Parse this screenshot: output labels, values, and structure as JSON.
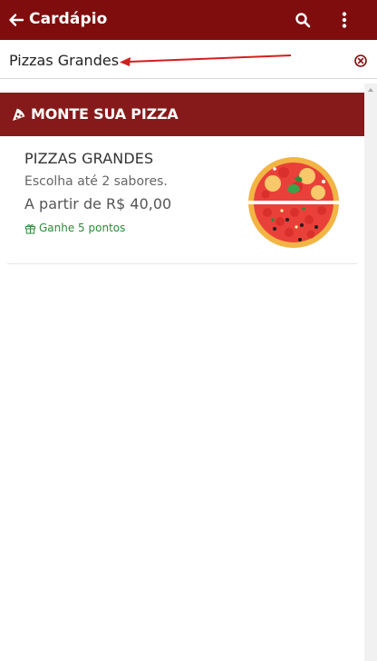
{
  "appbar": {
    "title": "Cardápio",
    "back_icon": "arrow-left-icon",
    "search_icon": "search-icon",
    "more_icon": "more-vertical-icon",
    "color": "#7f0d0d"
  },
  "search": {
    "value": "Pizzas Grandes",
    "placeholder": "",
    "clear_icon": "clear-circle-icon"
  },
  "section": {
    "title": "MONTE SUA PIZZA",
    "icon": "pizza-slice-icon",
    "color": "#861a1a"
  },
  "product": {
    "name": "PIZZAS GRANDES",
    "description": "Escolha até 2 sabores.",
    "price": "A partir de R$ 40,00",
    "points": "Ganhe 5 pontos",
    "points_icon": "gift-icon",
    "points_color": "#2e8a3a",
    "image": "pizza-image"
  }
}
